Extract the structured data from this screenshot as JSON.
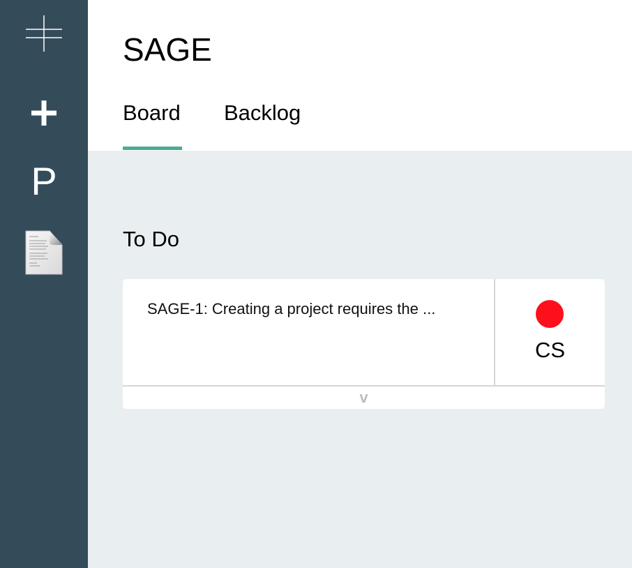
{
  "sidebar": {
    "logo_icon": "crosshair-logo-icon",
    "add_icon": "plus-icon",
    "add_glyph": "+",
    "project_glyph": "P",
    "document_icon": "document-icon"
  },
  "header": {
    "title": "SAGE",
    "tabs": [
      {
        "label": "Board",
        "active": true
      },
      {
        "label": "Backlog",
        "active": false
      }
    ]
  },
  "board": {
    "columns": [
      {
        "title": "To Do",
        "cards": [
          {
            "summary": "SAGE-1: Creating a project requires the ...",
            "status_color": "#fe0f1c",
            "assignee": "CS",
            "expand_label": "v"
          }
        ]
      }
    ]
  },
  "colors": {
    "sidebar": "#344b5a",
    "accent": "#4aab97",
    "board_bg": "#e9eef0",
    "status_red": "#fe0f1c"
  }
}
